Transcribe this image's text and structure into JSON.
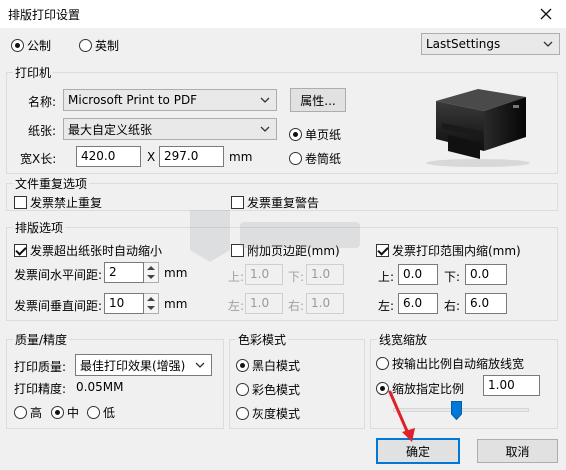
{
  "window": {
    "title": "排版打印设置"
  },
  "units": {
    "metric_label": "公制",
    "imperial_label": "英制",
    "selected": "metric"
  },
  "settings_combo": {
    "value": "LastSettings"
  },
  "printer_group": {
    "title": "打印机",
    "name_label": "名称:",
    "name_value": "Microsoft Print to PDF",
    "properties_button": "属性...",
    "paper_label": "纸张:",
    "paper_value": "最大自定义纸张",
    "sheet_label": "单页纸",
    "roll_label": "卷筒纸",
    "paper_mode": "sheet",
    "size_label": "宽X长:",
    "width_value": "420.0",
    "x_label": "X",
    "length_value": "297.0",
    "unit_label": "mm"
  },
  "duplicate_group": {
    "title": "文件重复选项",
    "forbid_label": "发票禁止重复",
    "forbid_checked": false,
    "warn_label": "发票重复警告",
    "warn_checked": false
  },
  "layout_group": {
    "title": "排版选项",
    "autoshrink_label": "发票超出纸张时自动缩小",
    "autoshrink_checked": true,
    "h_spacing_label": "发票间水平间距:",
    "h_spacing_value": "2",
    "v_spacing_label": "发票间垂直间距:",
    "v_spacing_value": "10",
    "mm1": "mm",
    "mm2": "mm",
    "margin_label": "附加页边距(mm)",
    "margin_checked": false,
    "m_top_label": "上:",
    "m_top_value": "1.0",
    "m_bottom_label": "下:",
    "m_bottom_value": "1.0",
    "m_left_label": "左:",
    "m_left_value": "1.0",
    "m_right_label": "右:",
    "m_right_value": "1.0",
    "inner_label": "发票打印范围内缩(mm)",
    "inner_checked": true,
    "i_top_label": "上:",
    "i_top_value": "0.0",
    "i_bottom_label": "下:",
    "i_bottom_value": "0.0",
    "i_left_label": "左:",
    "i_left_value": "6.0",
    "i_right_label": "右:",
    "i_right_value": "6.0"
  },
  "quality_group": {
    "title": "质量/精度",
    "quality_label": "打印质量:",
    "quality_value": "最佳打印效果(增强)",
    "precision_label": "打印精度:",
    "precision_value": "0.05MM",
    "high_label": "高",
    "mid_label": "中",
    "low_label": "低",
    "selected": "mid"
  },
  "color_group": {
    "title": "色彩模式",
    "bw_label": "黑白模式",
    "color_label": "彩色模式",
    "gray_label": "灰度模式",
    "selected": "bw"
  },
  "linewidth_group": {
    "title": "线宽缩放",
    "auto_label": "按输出比例自动缩放线宽",
    "fixed_label": "缩放指定比例",
    "selected": "fixed",
    "ratio_value": "1.00",
    "slider_fraction": 0.2
  },
  "buttons": {
    "ok": "确定",
    "cancel": "取消"
  },
  "icons": {
    "close": "close-icon",
    "printer": "printer-image",
    "annotation_arrow": "red-arrow-annotation",
    "watermark": "site-watermark-logo"
  },
  "colors": {
    "accent": "#0078d7",
    "arrow": "#e0202a"
  }
}
